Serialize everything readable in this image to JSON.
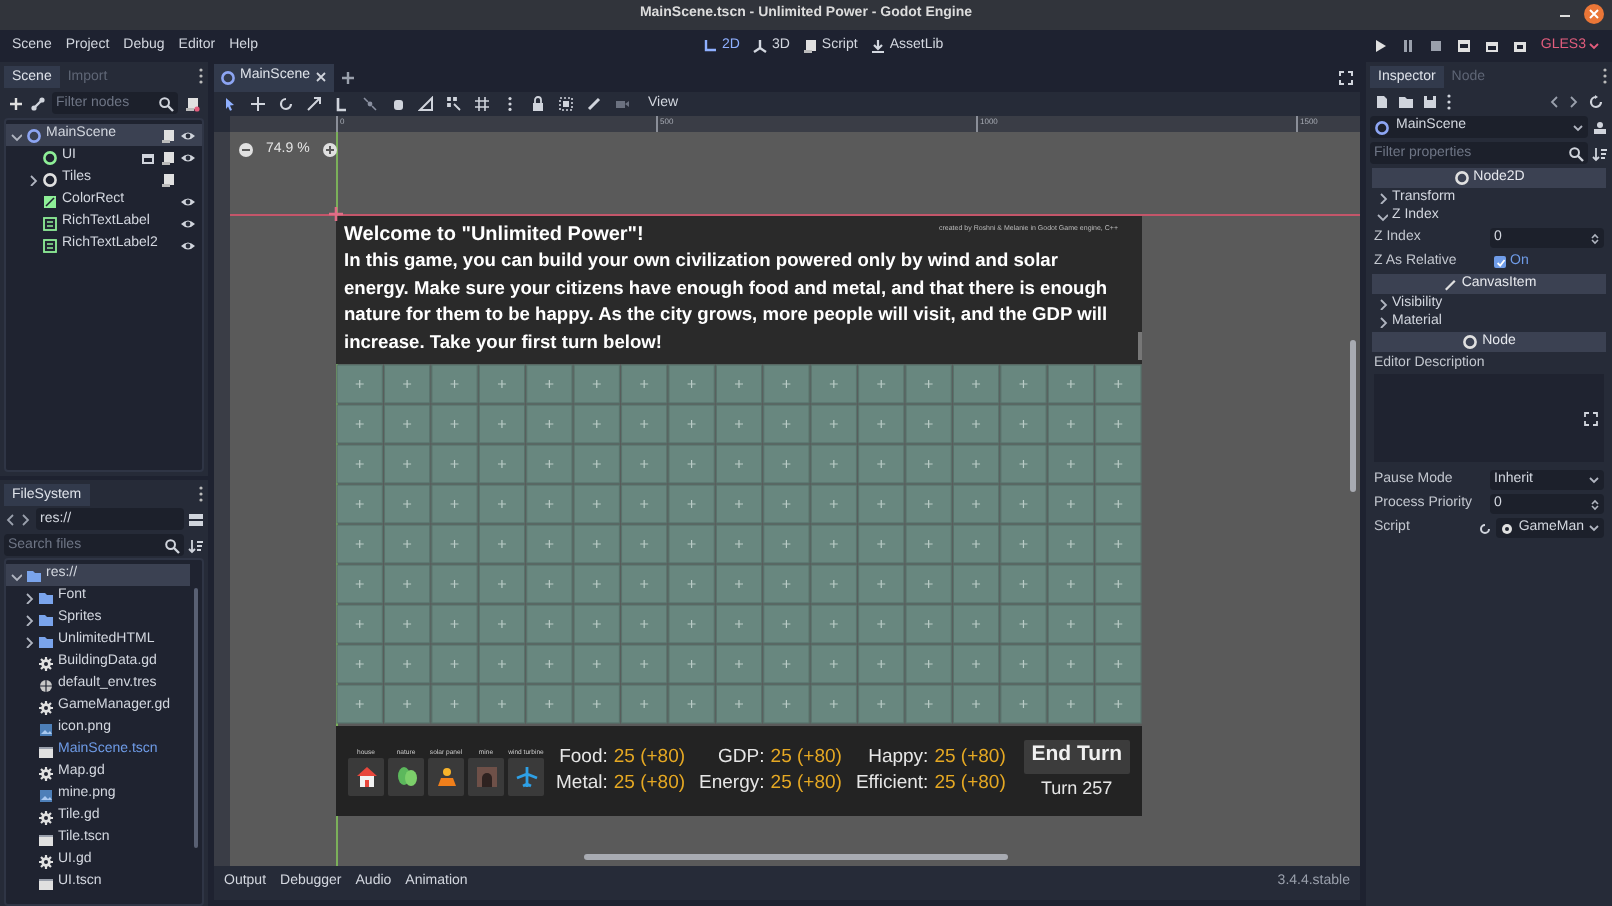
{
  "window": {
    "title": "MainScene.tscn - Unlimited Power - Godot Engine"
  },
  "menu": [
    "Scene",
    "Project",
    "Debug",
    "Editor",
    "Help"
  ],
  "workspaces": [
    {
      "label": "2D",
      "kind": "canvas",
      "selected": true
    },
    {
      "label": "3D",
      "kind": "spatial",
      "selected": false
    },
    {
      "label": "Script",
      "kind": "script",
      "selected": false
    },
    {
      "label": "AssetLib",
      "kind": "assetlib",
      "selected": false
    }
  ],
  "renderer": "GLES3",
  "scene_dock": {
    "tabs": [
      {
        "label": "Scene",
        "selected": true
      },
      {
        "label": "Import",
        "selected": false
      }
    ],
    "filter_placeholder": "Filter nodes",
    "tree": [
      {
        "label": "MainScene",
        "kind": "node2d",
        "selected": true,
        "expanded": true,
        "script": true,
        "eye": true,
        "group": false,
        "children": [
          {
            "label": "UI",
            "kind": "control",
            "selected": false,
            "script": true,
            "eye": true,
            "group": true
          },
          {
            "label": "Tiles",
            "kind": "node",
            "selected": false,
            "expanded": false,
            "script": true,
            "eye": false,
            "group": false
          },
          {
            "label": "ColorRect",
            "kind": "colorrect",
            "selected": false,
            "script": false,
            "eye": true,
            "group": false
          },
          {
            "label": "RichTextLabel",
            "kind": "richtext",
            "selected": false,
            "script": false,
            "eye": true,
            "group": false
          },
          {
            "label": "RichTextLabel2",
            "kind": "richtext",
            "selected": false,
            "script": false,
            "eye": true,
            "group": false
          }
        ]
      }
    ]
  },
  "filesystem": {
    "title": "FileSystem",
    "path": "res://",
    "search_placeholder": "Search files",
    "tree": [
      {
        "label": "res://",
        "kind": "folder",
        "selected": true,
        "current": false,
        "expanded": true,
        "children": [
          {
            "label": "Font",
            "kind": "folder",
            "selected": false,
            "current": false,
            "expanded": false
          },
          {
            "label": "Sprites",
            "kind": "folder",
            "selected": false,
            "current": false,
            "expanded": false
          },
          {
            "label": "UnlimitedHTML",
            "kind": "folder",
            "selected": false,
            "current": false,
            "expanded": false
          },
          {
            "label": "BuildingData.gd",
            "kind": "script",
            "selected": false,
            "current": false
          },
          {
            "label": "default_env.tres",
            "kind": "resource",
            "selected": false,
            "current": false
          },
          {
            "label": "GameManager.gd",
            "kind": "script",
            "selected": false,
            "current": false
          },
          {
            "label": "icon.png",
            "kind": "image",
            "selected": false,
            "current": false
          },
          {
            "label": "MainScene.tscn",
            "kind": "scene",
            "selected": false,
            "current": true
          },
          {
            "label": "Map.gd",
            "kind": "script",
            "selected": false,
            "current": false
          },
          {
            "label": "mine.png",
            "kind": "image",
            "selected": false,
            "current": false
          },
          {
            "label": "Tile.gd",
            "kind": "script",
            "selected": false,
            "current": false
          },
          {
            "label": "Tile.tscn",
            "kind": "scene",
            "selected": false,
            "current": false
          },
          {
            "label": "UI.gd",
            "kind": "script",
            "selected": false,
            "current": false
          },
          {
            "label": "UI.tscn",
            "kind": "scene",
            "selected": false,
            "current": false
          }
        ]
      }
    ]
  },
  "editor_tabs": [
    {
      "label": "MainScene",
      "selected": true
    }
  ],
  "toolbar": {
    "view_menu": "View"
  },
  "viewport": {
    "zoom": "74.9 %",
    "ruler": [
      "0",
      "500",
      "1000",
      "1500"
    ],
    "game": {
      "intro_title": "Welcome to \"Unlimited Power\"!",
      "intro_body": "In this game, you can build your own civilization powered only by wind and solar energy. Make sure your citizens have enough food and metal, and that there is enough nature for them to be happy. As the city grows, more people will visit, and the GDP will increase.  Take your first turn below!",
      "credit": "created by Roshni & Melanie in Godot Game engine, C++",
      "buildings": [
        {
          "label": "house",
          "kind": "house"
        },
        {
          "label": "nature",
          "kind": "nature"
        },
        {
          "label": "solar panel",
          "kind": "solar"
        },
        {
          "label": "mine",
          "kind": "mine"
        },
        {
          "label": "wind turbine",
          "kind": "wind"
        }
      ],
      "stats": [
        {
          "label": "Food:",
          "value": "25 (+80)"
        },
        {
          "label": "GDP:",
          "value": "25 (+80)"
        },
        {
          "label": "Happy:",
          "value": "25 (+80)"
        },
        {
          "label": "Metal:",
          "value": "25 (+80)"
        },
        {
          "label": "Energy:",
          "value": "25 (+80)"
        },
        {
          "label": "Efficient:",
          "value": "25 (+80)"
        }
      ],
      "end_turn": "End Turn",
      "turn": "Turn 257"
    }
  },
  "bottom_tabs": [
    "Output",
    "Debugger",
    "Audio",
    "Animation"
  ],
  "version": "3.4.4.stable",
  "inspector": {
    "tabs": [
      {
        "label": "Inspector",
        "selected": true
      },
      {
        "label": "Node",
        "selected": false
      }
    ],
    "object": "MainScene",
    "filter_placeholder": "Filter properties",
    "rows": [
      {
        "kind": "category",
        "label": "Node2D"
      },
      {
        "kind": "group",
        "label": "Transform",
        "expanded": false
      },
      {
        "kind": "group",
        "label": "Z Index",
        "expanded": true
      },
      {
        "kind": "number",
        "label": "Z Index",
        "value": "0"
      },
      {
        "kind": "check",
        "label": "Z As Relative",
        "value": "On",
        "checked": true
      },
      {
        "kind": "category",
        "label": "CanvasItem"
      },
      {
        "kind": "group",
        "label": "Visibility",
        "expanded": false
      },
      {
        "kind": "group",
        "label": "Material",
        "expanded": false
      },
      {
        "kind": "category",
        "label": "Node"
      },
      {
        "kind": "textarea",
        "label": "Editor Description"
      },
      {
        "kind": "select",
        "label": "Pause Mode",
        "value": "Inherit"
      },
      {
        "kind": "number",
        "label": "Process Priority",
        "value": "0"
      },
      {
        "kind": "resource",
        "label": "Script",
        "value": "GameMan"
      }
    ]
  }
}
